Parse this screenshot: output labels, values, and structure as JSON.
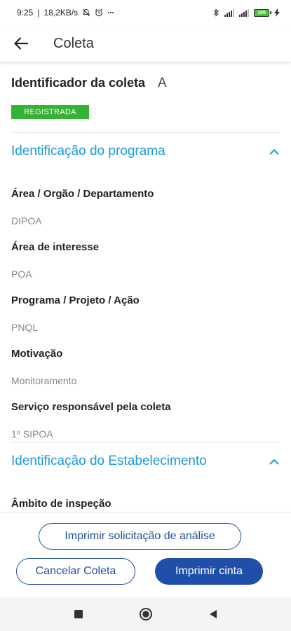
{
  "status_bar": {
    "time": "9:25",
    "net_speed": "18,2KB/s",
    "more": "···",
    "battery_level": "100"
  },
  "app_bar": {
    "title": "Coleta"
  },
  "collection": {
    "id_label": "Identificador da coleta",
    "id_value": "A",
    "status_badge": "REGISTRADA"
  },
  "sections": [
    {
      "title": "Identificação do programa",
      "expanded": true,
      "fields": [
        {
          "label": "Área / Orgão / Departamento",
          "value": "DIPOA"
        },
        {
          "label": "Área de interesse",
          "value": "POA"
        },
        {
          "label": "Programa / Projeto / Ação",
          "value": "PNQL"
        },
        {
          "label": "Motivação",
          "value": "Monitoramento"
        },
        {
          "label": "Serviço responsável pela coleta",
          "value": "1º SIPOA"
        }
      ]
    },
    {
      "title": "Identificação do Estabelecimento",
      "expanded": true,
      "fields": [
        {
          "label": "Âmbito de inspeção",
          "value": ""
        }
      ]
    }
  ],
  "actions": {
    "print_request": "Imprimir solicitação de análise",
    "cancel": "Cancelar Coleta",
    "print_label": "Imprimir cinta"
  },
  "colors": {
    "accent": "#1a9ae0",
    "primary": "#1f4fa8",
    "badge": "#34b233"
  }
}
